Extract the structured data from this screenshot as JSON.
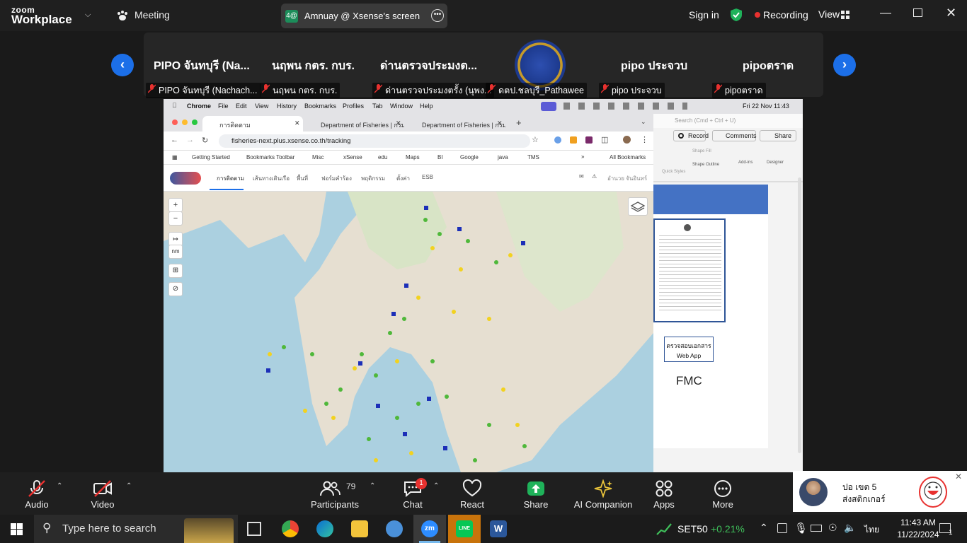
{
  "app": {
    "logo_top": "zoom",
    "logo_bottom": "Workplace",
    "meeting_label": "Meeting"
  },
  "share_pill": {
    "avatar": "4@",
    "title": "Amnuay @ Xsense's screen"
  },
  "topbar": {
    "sign_in": "Sign in",
    "recording": "Recording",
    "view": "View"
  },
  "gallery": {
    "tiles": [
      {
        "name": "PIPO จันทบุรี (Na...",
        "label": "PIPO จันทบุรี (Nachach..."
      },
      {
        "name": "นฤพน  กตร. กบร.",
        "label": "นฤพน  กตร. กบร."
      },
      {
        "name": "ด่านตรวจประมงต...",
        "label": "ด่านตรวจประมงตรั้ง (นุพง..."
      },
      {
        "name": "",
        "label": "ดตป.ชลบุรี_Pathawee"
      },
      {
        "name": "pipo ประจวบ",
        "label": "pipo ประจวบ"
      },
      {
        "name": "pipoตราด",
        "label": "pipoตราด"
      }
    ]
  },
  "mac_menu": [
    "Chrome",
    "File",
    "Edit",
    "View",
    "History",
    "Bookmarks",
    "Profiles",
    "Tab",
    "Window",
    "Help"
  ],
  "mac_clock": "Fri 22 Nov  11:43",
  "browser": {
    "tabs": [
      "การติดตาม",
      "Department of Fisheries | กรม",
      "Department of Fisheries | กรม"
    ],
    "url": "fisheries-next.plus.xsense.co.th/tracking",
    "bookmarks": [
      "Getting Started",
      "Bookmarks Toolbar",
      "Misc",
      "xSense",
      "edu",
      "Maps",
      "BI",
      "Google",
      "java",
      "TMS"
    ],
    "all_bookmarks": "All Bookmarks",
    "nav": [
      "การติดตาม",
      "เส้นทางเดินเรือ",
      "พื้นที่",
      "ฟอร์มคำร้อง",
      "พฤติกรรม",
      "ตั้งค่า",
      "ESB"
    ],
    "user": "อำนวย จันอินทร์",
    "map_buttons": [
      "+",
      "−",
      "↦",
      "nm",
      "⊞",
      "⊘"
    ]
  },
  "ppt": {
    "search": "Search (Cmd + Ctrl + U)",
    "record": "Record",
    "comments": "Comments",
    "share": "Share",
    "ribbon": [
      "Quick Styles",
      "Shape Fill",
      "Shape Outline",
      "Add-ins",
      "Designer"
    ],
    "box_line1": "ตรวจสอบเอกสาร",
    "box_line2": "Web App",
    "fmc": "FMC"
  },
  "toolbar": {
    "audio": "Audio",
    "video": "Video",
    "participants": "Participants",
    "participant_count": "79",
    "chat": "Chat",
    "chat_badge": "1",
    "react": "React",
    "share": "Share",
    "ai": "AI Companion",
    "apps": "Apps",
    "more": "More"
  },
  "notice": {
    "name": "ปอ เขต 5",
    "msg": "ส่งสติกเกอร์"
  },
  "taskbar": {
    "search_placeholder": "Type here to search",
    "stock_name": "SET50",
    "stock_change": "+0.21%",
    "lang": "ไทย",
    "time": "11:43 AM",
    "date": "11/22/2024",
    "notif": "1"
  },
  "colors": {
    "accent_blue": "#1c6fe8",
    "share_green": "#1fb25a",
    "record_red": "#e8312f",
    "shield_green": "#1fb25a"
  }
}
